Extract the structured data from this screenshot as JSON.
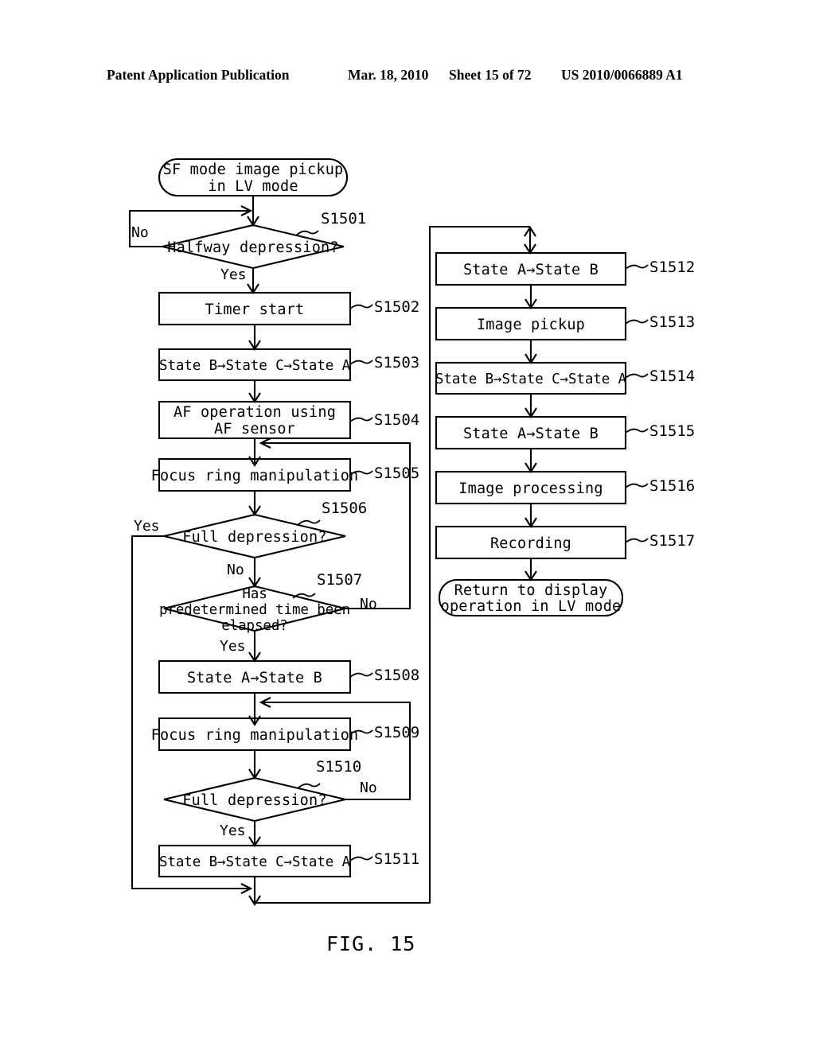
{
  "header": {
    "publication": "Patent Application Publication",
    "date": "Mar. 18, 2010",
    "sheet": "Sheet 15 of 72",
    "patent_number": "US 2010/0066889 A1"
  },
  "figure": {
    "caption": "FIG. 15"
  },
  "flowchart": {
    "start": {
      "line1": "SF mode image pickup",
      "line2": "in LV mode"
    },
    "end": {
      "line1": "Return to display",
      "line2": "operation in LV mode"
    },
    "nodes": [
      {
        "id": "S1501",
        "type": "decision",
        "label": "Halfway depression?",
        "ref": "S1501"
      },
      {
        "id": "S1502",
        "type": "process",
        "label": "Timer start",
        "ref": "S1502"
      },
      {
        "id": "S1503",
        "type": "process",
        "label": "State B→State C→State A",
        "ref": "S1503"
      },
      {
        "id": "S1504",
        "type": "process",
        "label_line1": "AF operation using",
        "label_line2": "AF sensor",
        "ref": "S1504"
      },
      {
        "id": "S1505",
        "type": "process",
        "label": "Focus ring manipulation",
        "ref": "S1505"
      },
      {
        "id": "S1506",
        "type": "decision",
        "label": "Full depression?",
        "ref": "S1506"
      },
      {
        "id": "S1507",
        "type": "decision",
        "label_line1": "Has",
        "label_line2": "predetermined time been",
        "label_line3": "elapsed?",
        "ref": "S1507"
      },
      {
        "id": "S1508",
        "type": "process",
        "label": "State A→State B",
        "ref": "S1508"
      },
      {
        "id": "S1509",
        "type": "process",
        "label": "Focus ring manipulation",
        "ref": "S1509"
      },
      {
        "id": "S1510",
        "type": "decision",
        "label": "Full depression?",
        "ref": "S1510"
      },
      {
        "id": "S1511",
        "type": "process",
        "label": "State B→State C→State A",
        "ref": "S1511"
      },
      {
        "id": "S1512",
        "type": "process",
        "label": "State A→State B",
        "ref": "S1512"
      },
      {
        "id": "S1513",
        "type": "process",
        "label": "Image pickup",
        "ref": "S1513"
      },
      {
        "id": "S1514",
        "type": "process",
        "label": "State B→State C→State A",
        "ref": "S1514"
      },
      {
        "id": "S1515",
        "type": "process",
        "label": "State A→State B",
        "ref": "S1515"
      },
      {
        "id": "S1516",
        "type": "process",
        "label": "Image processing",
        "ref": "S1516"
      },
      {
        "id": "S1517",
        "type": "process",
        "label": "Recording",
        "ref": "S1517"
      }
    ],
    "branch_labels": {
      "s1501_no": "No",
      "s1501_yes": "Yes",
      "s1506_yes": "Yes",
      "s1506_no": "No",
      "s1507_no": "No",
      "s1507_yes": "Yes",
      "s1510_no": "No",
      "s1510_yes": "Yes"
    }
  }
}
